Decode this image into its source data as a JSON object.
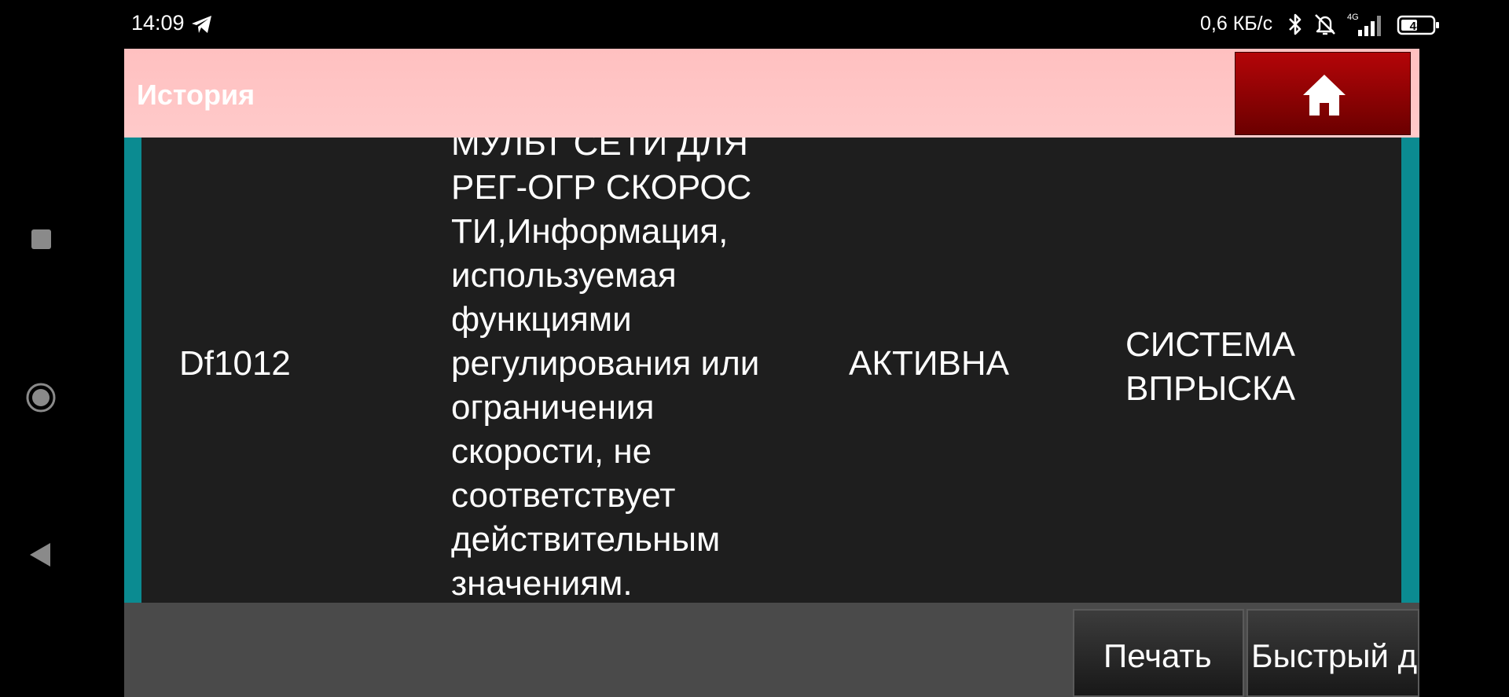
{
  "status_bar": {
    "time": "14:09",
    "network_speed": "0,6 КБ/с",
    "network_type": "4G",
    "battery": "48",
    "icons": [
      "telegram-icon",
      "bluetooth-icon",
      "bell-off-icon",
      "signal-icon",
      "battery-icon"
    ]
  },
  "nav": {
    "icons": [
      "recents-icon",
      "home-circle-icon",
      "back-icon"
    ]
  },
  "header": {
    "title": "История",
    "home_icon": "home-icon"
  },
  "row": {
    "code": "Df1012",
    "description": "МУЛЬТ СЕТИ ДЛЯ РЕГ-ОГР СКОРОС ТИ,Информация, используемая функциями регулирования или ограничения скорости, не соответствует действительным значениям.",
    "status": "АКТИВНА",
    "system": "СИСТЕМА ВПРЫСКА"
  },
  "footer": {
    "print_label": "Печать",
    "quick_label": "Быстрый д"
  },
  "colors": {
    "header_bg": "#ffc4c4",
    "home_button": "#a00000",
    "accent": "#0b8b91",
    "content_bg": "#1e1e1e",
    "footer_bg": "#4a4a4a"
  }
}
